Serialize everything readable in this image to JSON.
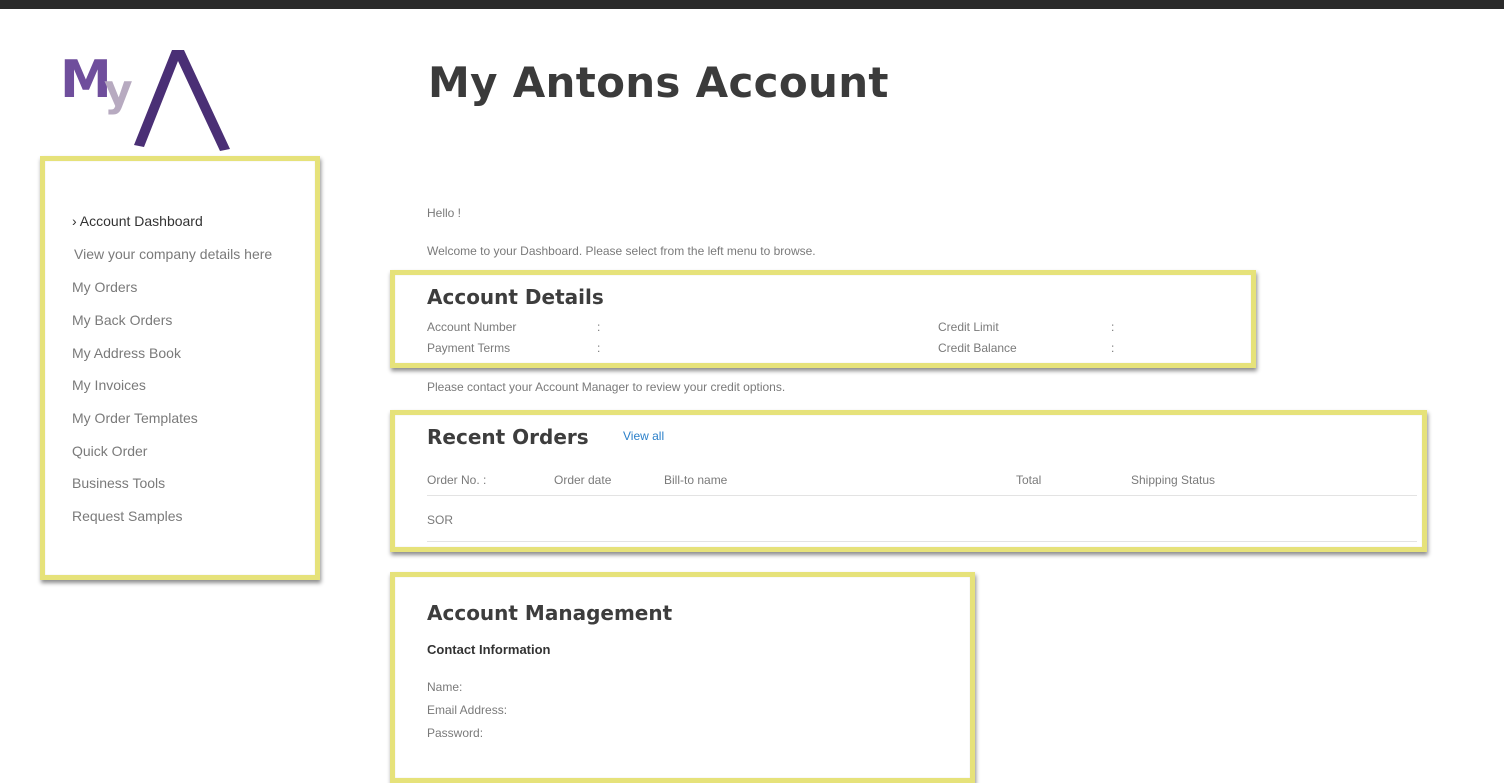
{
  "colors": {
    "logo_purple": "#6f4e9c",
    "logo_grey": "#b7aac0",
    "logo_dark": "#4a2f75",
    "highlight": "#e6e27a",
    "link": "#2a7fc9"
  },
  "logo": {
    "text_m": "M",
    "text_y": "y"
  },
  "page_title": "My Antons Account",
  "sidebar": {
    "items": [
      {
        "label": "› Account Dashboard"
      },
      {
        "label": "View your company details here"
      },
      {
        "label": "My Orders"
      },
      {
        "label": "My Back Orders"
      },
      {
        "label": "My Address Book"
      },
      {
        "label": "My Invoices"
      },
      {
        "label": "My Order Templates"
      },
      {
        "label": "Quick Order"
      },
      {
        "label": "Business Tools"
      },
      {
        "label": "Request Samples"
      }
    ]
  },
  "greeting": "Hello !",
  "welcome": "Welcome to your Dashboard. Please select from the left menu to browse.",
  "account_details": {
    "title": "Account Details",
    "account_number_label": "Account Number",
    "payment_terms_label": "Payment Terms",
    "credit_limit_label": "Credit Limit",
    "credit_balance_label": "Credit Balance",
    "colon": ":"
  },
  "credit_note": "Please contact your Account Manager to review your credit options.",
  "recent_orders": {
    "title": "Recent Orders",
    "view_all": "View all",
    "columns": [
      "Order No. :",
      "Order date",
      "Bill-to name",
      "Total",
      "Shipping Status"
    ],
    "rows": [
      {
        "order_no": "SOR"
      }
    ]
  },
  "account_management": {
    "title": "Account Management",
    "contact_title": "Contact Information",
    "name_label": "Name:",
    "email_label": "Email Address:",
    "password_label": "Password:"
  }
}
